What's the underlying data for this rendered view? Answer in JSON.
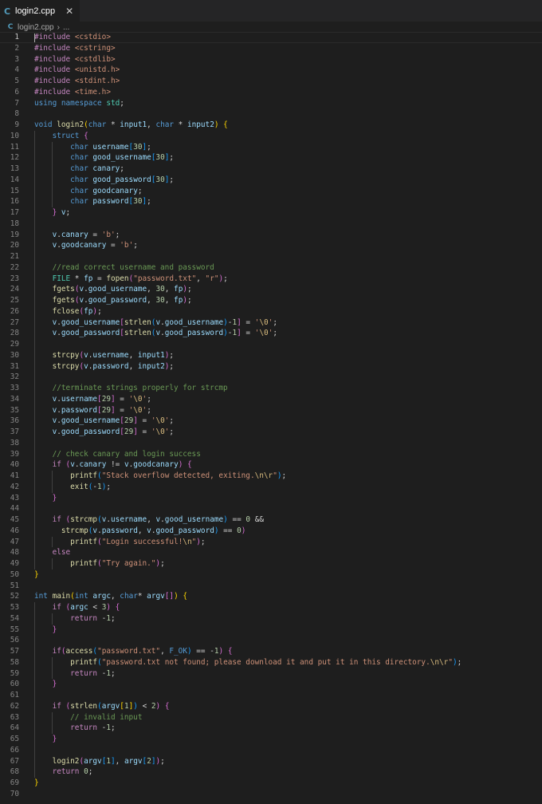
{
  "tab": {
    "title": "login2.cpp",
    "icon": "cpp-file-icon",
    "close": "✕"
  },
  "breadcrumb": {
    "file": "login2.cpp",
    "rest": "..."
  },
  "editor": {
    "active_line": 1,
    "lines": [
      "#include <cstdio>",
      "#include <cstring>",
      "#include <cstdlib>",
      "#include <unistd.h>",
      "#include <stdint.h>",
      "#include <time.h>",
      "using namespace std;",
      "",
      "void login2(char * input1, char * input2) {",
      "    struct {",
      "        char username[30];",
      "        char good_username[30];",
      "        char canary;",
      "        char good_password[30];",
      "        char goodcanary;",
      "        char password[30];",
      "    } v;",
      "",
      "    v.canary = 'b';",
      "    v.goodcanary = 'b';",
      "",
      "    //read correct username and password",
      "    FILE * fp = fopen(\"password.txt\", \"r\");",
      "    fgets(v.good_username, 30, fp);",
      "    fgets(v.good_password, 30, fp);",
      "    fclose(fp);",
      "    v.good_username[strlen(v.good_username)-1] = '\\0';",
      "    v.good_password[strlen(v.good_password)-1] = '\\0';",
      "",
      "    strcpy(v.username, input1);",
      "    strcpy(v.password, input2);",
      "",
      "    //terminate strings properly for strcmp",
      "    v.username[29] = '\\0';",
      "    v.password[29] = '\\0';",
      "    v.good_username[29] = '\\0';",
      "    v.good_password[29] = '\\0';",
      "",
      "    // check canary and login success",
      "    if (v.canary != v.goodcanary) {",
      "        printf(\"Stack overflow detected, exiting.\\n\\r\");",
      "        exit(-1);",
      "    }",
      "",
      "    if (strcmp(v.username, v.good_username) == 0 &&",
      "      strcmp(v.password, v.good_password) == 0)",
      "        printf(\"Login successful!\\n\");",
      "    else",
      "        printf(\"Try again.\");",
      "}",
      "",
      "int main(int argc, char* argv[]) {",
      "    if (argc < 3) {",
      "        return -1;",
      "    }",
      "",
      "    if(access(\"password.txt\", F_OK) == -1) {",
      "        printf(\"password.txt not found; please download it and put it in this directory.\\n\\r\");",
      "        return -1;",
      "    }",
      "",
      "    if (strlen(argv[1]) < 2) {",
      "        // invalid input",
      "        return -1;",
      "    }",
      "",
      "    login2(argv[1], argv[2]);",
      "    return 0;",
      "}",
      ""
    ]
  }
}
